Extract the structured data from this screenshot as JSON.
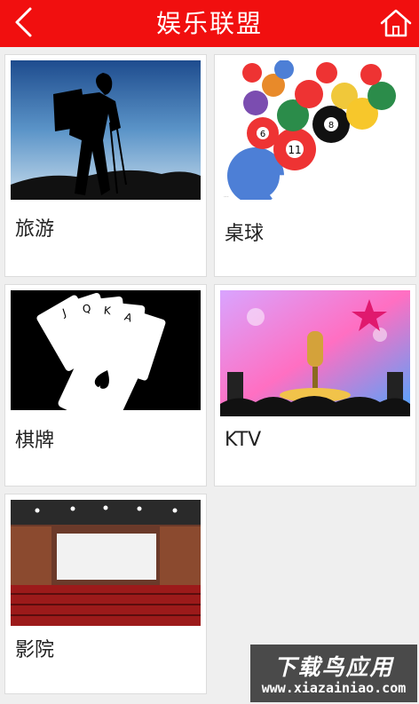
{
  "header": {
    "title": "娱乐联盟",
    "back_icon": "chevron-left-icon",
    "home_icon": "home-icon"
  },
  "colors": {
    "header_bg": "#f10f0f",
    "page_bg": "#efefef"
  },
  "categories": [
    {
      "label": "旅游",
      "image": "hiker-silhouette"
    },
    {
      "label": "桌球",
      "image": "billiard-balls"
    },
    {
      "label": "棋牌",
      "image": "playing-cards"
    },
    {
      "label": "KTV",
      "image": "microphone-stage"
    },
    {
      "label": "影院",
      "image": "cinema-hall"
    }
  ],
  "watermark": {
    "top_text": "下载鸟应用",
    "bottom_text": "www.xiazainiao.com"
  }
}
